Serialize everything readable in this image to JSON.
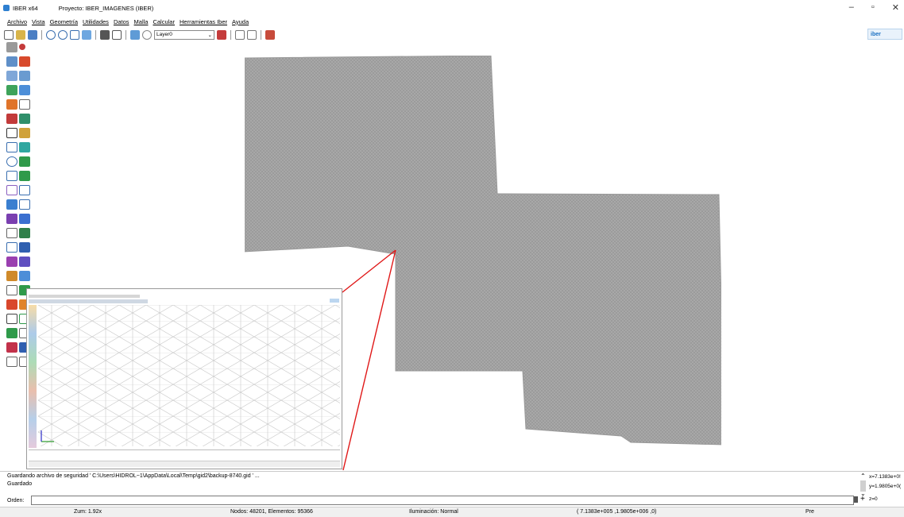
{
  "window": {
    "app_name": "IBER x64",
    "project_title": "Proyecto: IBER_IMAGENES (IBER)",
    "minimize": "–",
    "maximize": "▫",
    "close": "✕"
  },
  "menu": [
    "Archivo",
    "Vista",
    "Geometría",
    "Utilidades",
    "Datos",
    "Malla",
    "Calcular",
    "Herramientas Iber",
    "Ayuda"
  ],
  "toolbar": {
    "layer_value": "Layer0",
    "layer_arrow": "⌄",
    "logo_text": "iber"
  },
  "log": {
    "line1": "Guardando archivo de seguridad ' C:\\Users\\HIDROL~1\\AppData\\Local\\Temp\\gid2\\backup-8740.gid ' ...",
    "line2": "Guardado"
  },
  "coords": {
    "x": "x=7.1383e+0!",
    "y": "y=1.9805e+0(",
    "z": "z=0"
  },
  "order": {
    "label": "Orden:",
    "value": ""
  },
  "status": {
    "zoom": "Zum: 1.92x",
    "nodes": "Nodos: 48201, Elementos: 95366",
    "lighting": "Iluminación: Normal",
    "position": "( 7.1383e+005 ,1.9805e+006 ,0)",
    "mode": "Pre"
  }
}
